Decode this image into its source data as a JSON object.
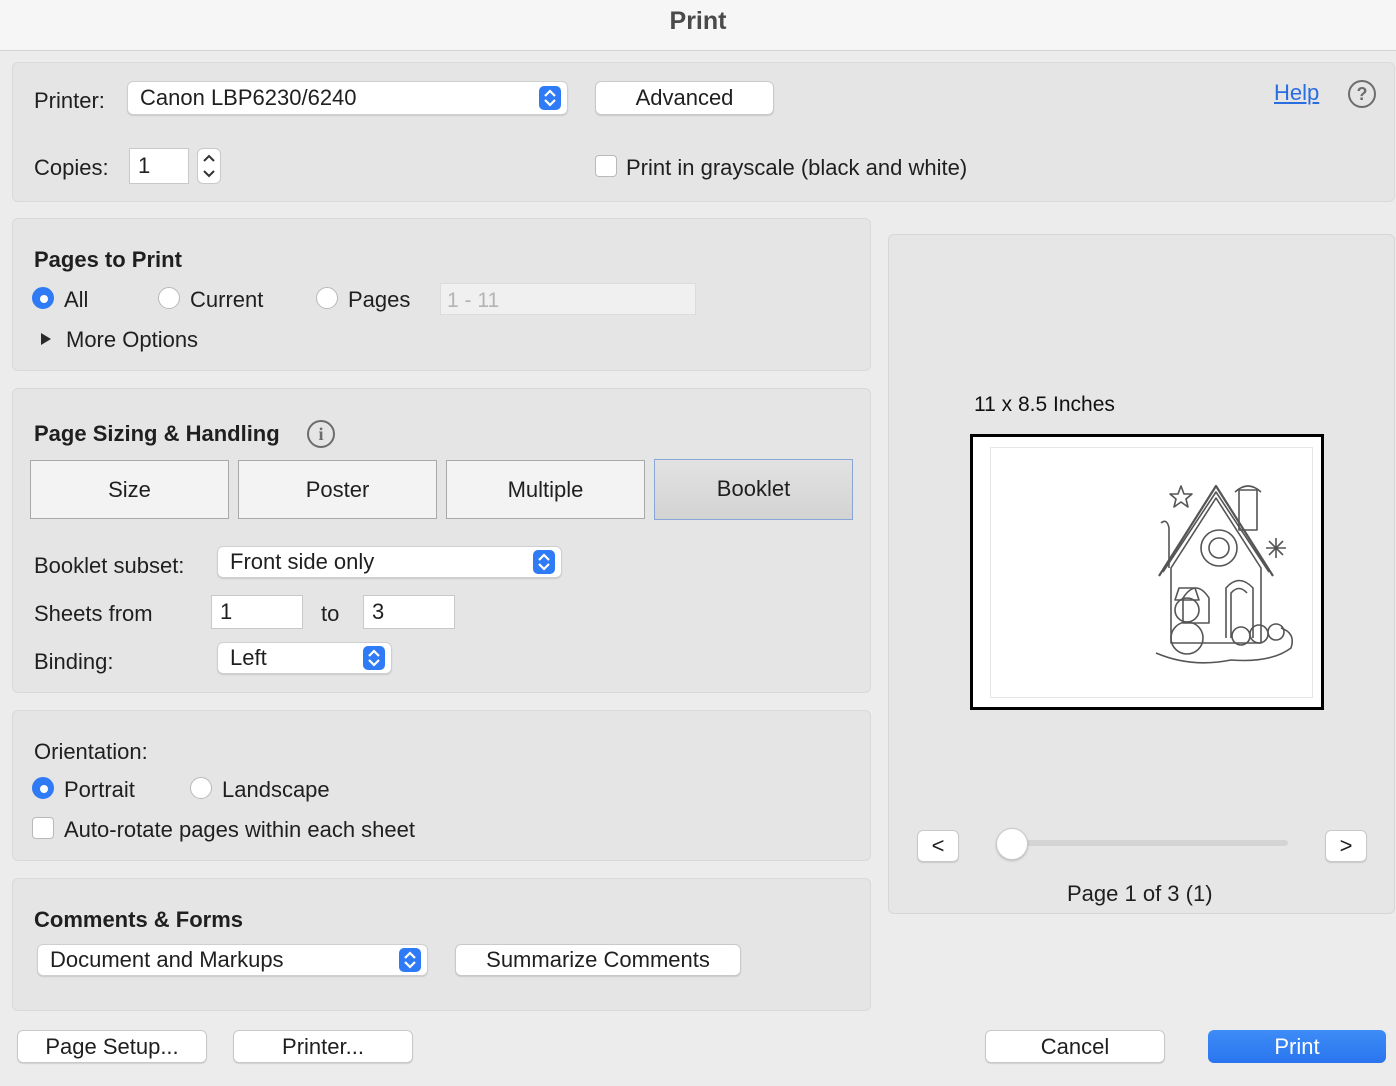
{
  "window": {
    "title": "Print"
  },
  "printer": {
    "label": "Printer:",
    "value": "Canon LBP6230/6240",
    "advanced_label": "Advanced",
    "help_label": "Help",
    "help_icon": "?"
  },
  "copies": {
    "label": "Copies:",
    "value": "1",
    "grayscale_label": "Print in grayscale (black and white)",
    "grayscale_checked": false
  },
  "pages_to_print": {
    "heading": "Pages to Print",
    "options": [
      {
        "label": "All",
        "selected": true
      },
      {
        "label": "Current",
        "selected": false
      },
      {
        "label": "Pages",
        "selected": false
      }
    ],
    "range_placeholder": "1 - 11",
    "more_options_label": "More Options"
  },
  "sizing": {
    "heading": "Page Sizing & Handling",
    "info_icon": "i",
    "tabs": [
      {
        "label": "Size",
        "active": false
      },
      {
        "label": "Poster",
        "active": false
      },
      {
        "label": "Multiple",
        "active": false
      },
      {
        "label": "Booklet",
        "active": true
      }
    ],
    "booklet_subset_label": "Booklet subset:",
    "booklet_subset_value": "Front side only",
    "sheets_from_label": "Sheets from",
    "sheets_from_value": "1",
    "sheets_to_label": "to",
    "sheets_to_value": "3",
    "binding_label": "Binding:",
    "binding_value": "Left"
  },
  "orientation": {
    "heading": "Orientation:",
    "options": [
      {
        "label": "Portrait",
        "selected": true
      },
      {
        "label": "Landscape",
        "selected": false
      }
    ],
    "autorotate_label": "Auto-rotate pages within each sheet",
    "autorotate_checked": false
  },
  "comments_forms": {
    "heading": "Comments & Forms",
    "value": "Document and Markups",
    "summarize_label": "Summarize Comments"
  },
  "preview": {
    "size_label": "11 x 8.5 Inches",
    "prev_label": "<",
    "next_label": ">",
    "page_status": "Page 1 of 3 (1)",
    "slider_fraction": 0
  },
  "footer": {
    "page_setup_label": "Page Setup...",
    "printer_label": "Printer...",
    "cancel_label": "Cancel",
    "print_label": "Print"
  },
  "colors": {
    "accent": "#2f7bf5",
    "link": "#2a6de0",
    "panel": "#e5e5e5"
  }
}
